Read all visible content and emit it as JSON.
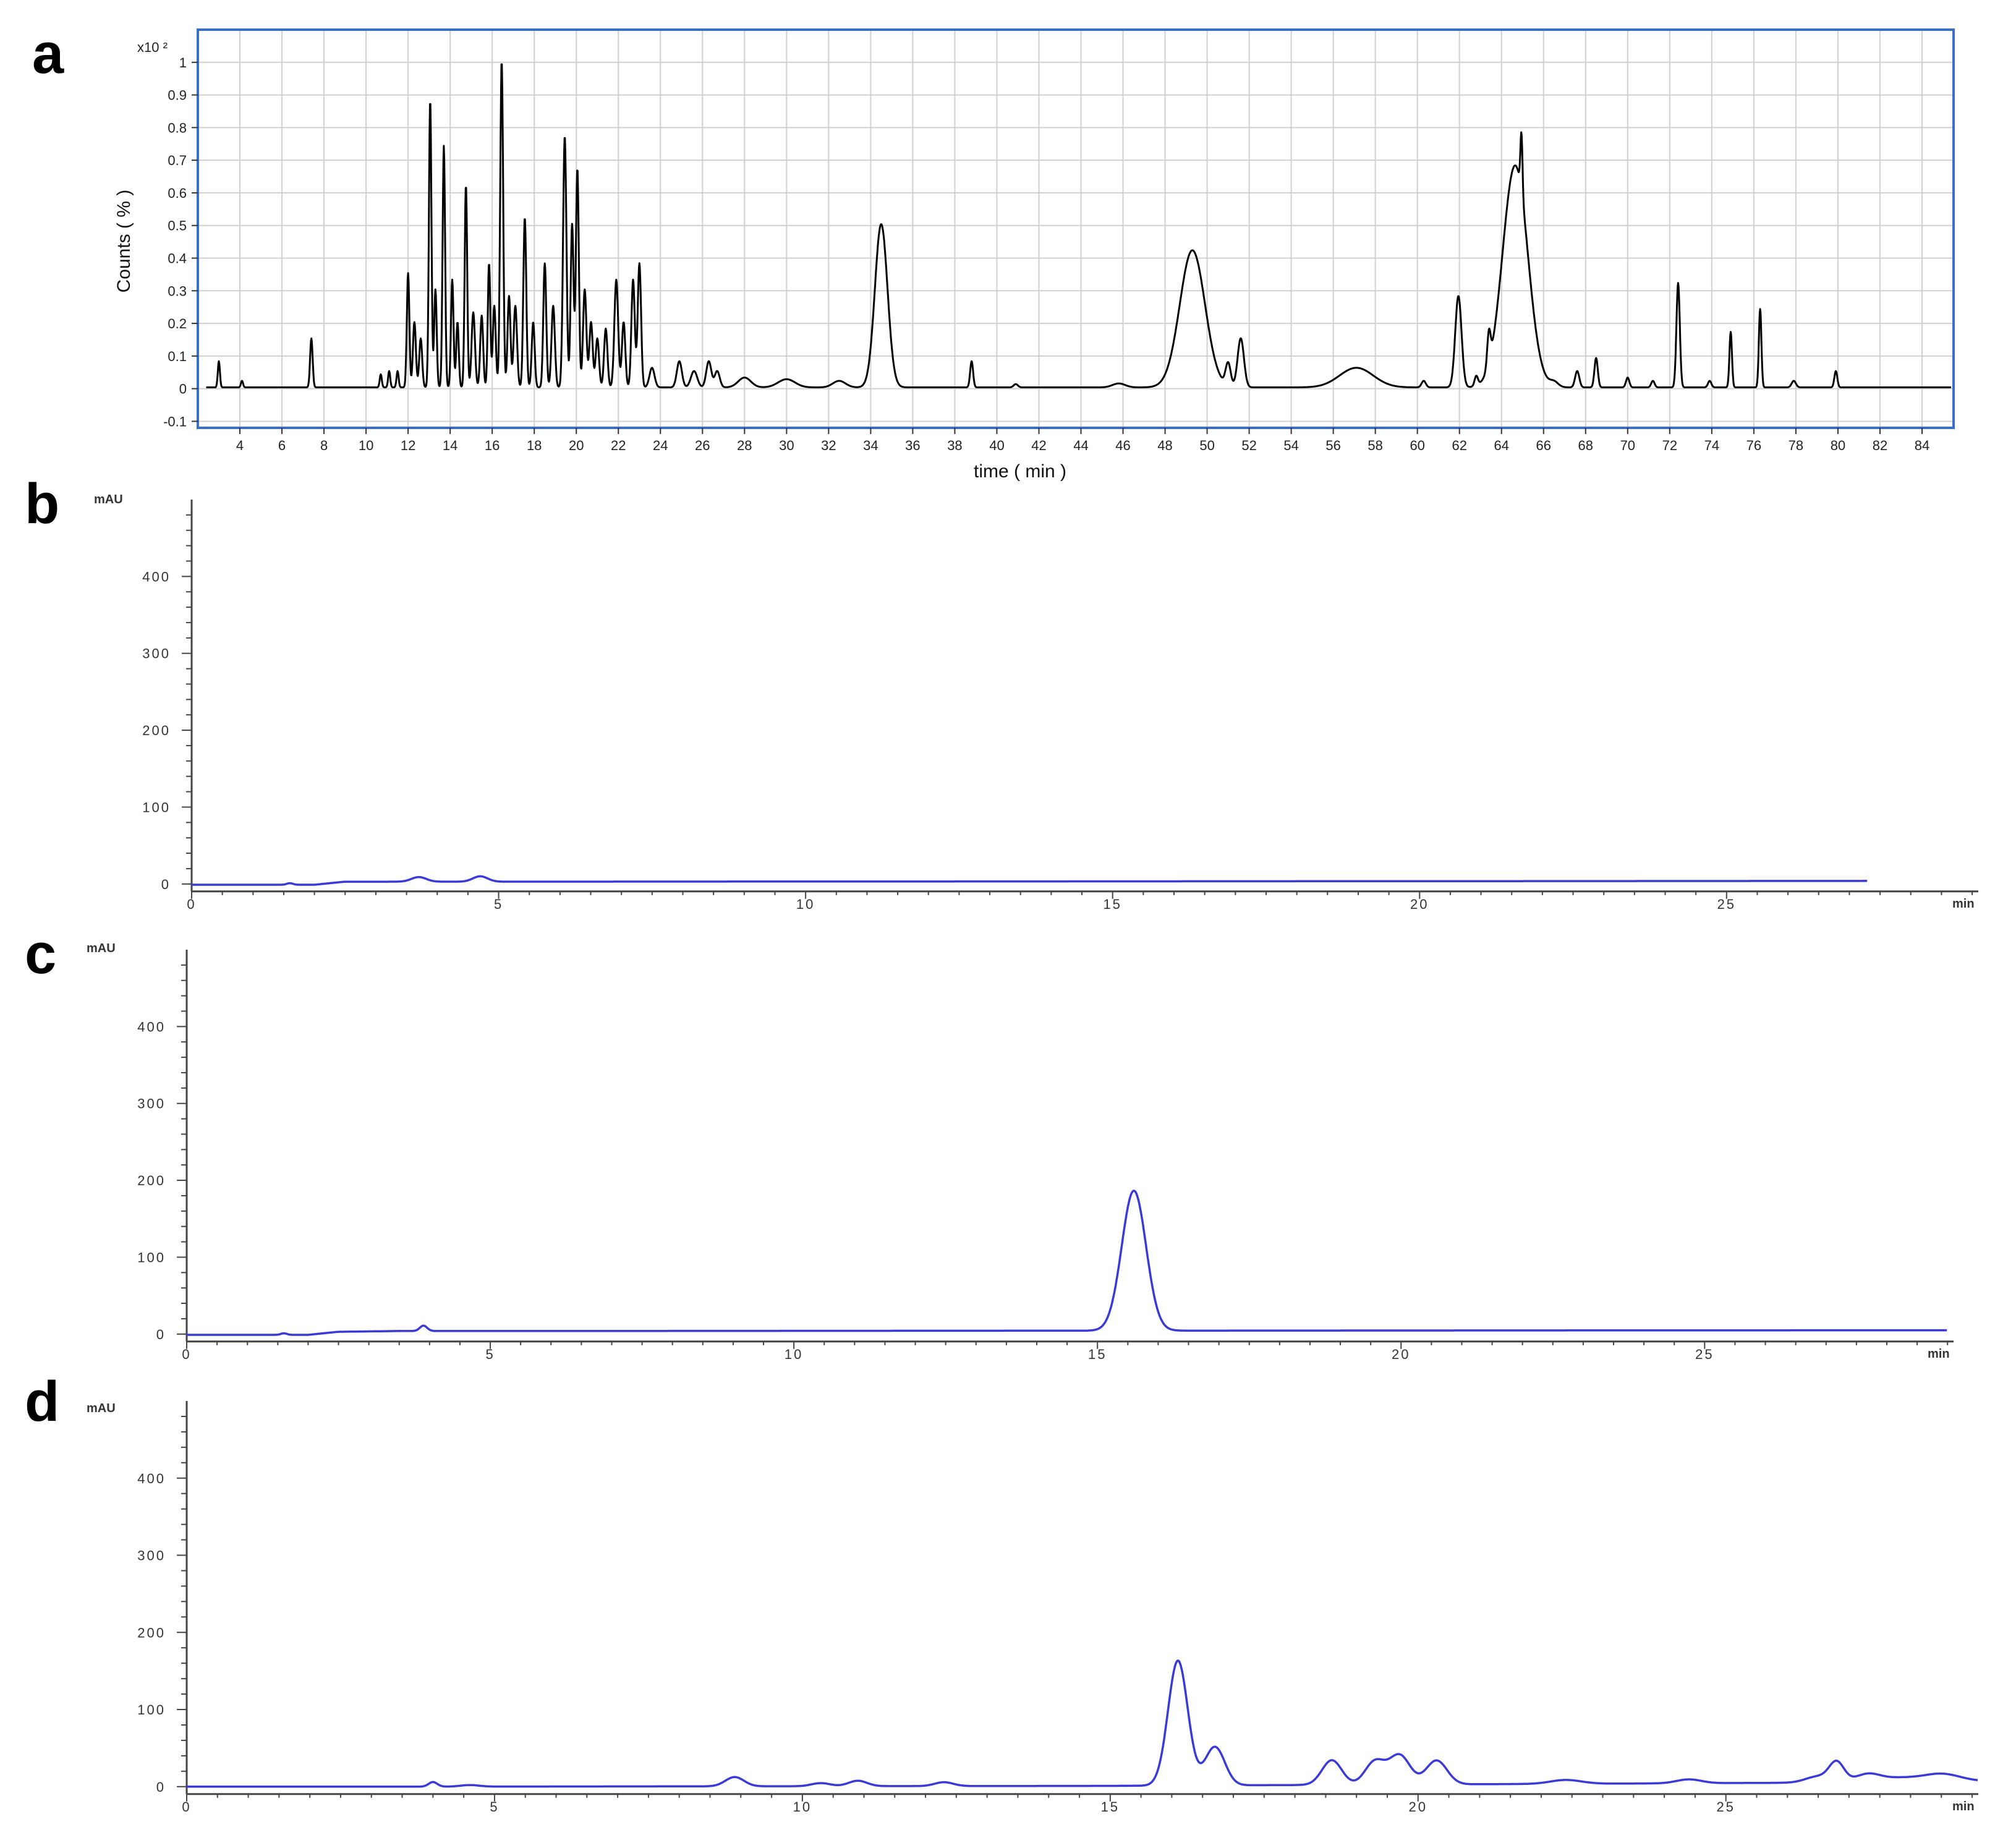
{
  "panels": {
    "a": {
      "letter": "a"
    },
    "b": {
      "letter": "b"
    },
    "c": {
      "letter": "c"
    },
    "d": {
      "letter": "d"
    }
  },
  "colors": {
    "ms_trace": "#000000",
    "uv_trace": "#3a3ad6",
    "frame_a": "#3a6fc4",
    "grid": "#d0d0d0"
  },
  "chart_data": [
    {
      "id": "a",
      "type": "line",
      "title": "",
      "xlabel": "time ( min )",
      "ylabel": "Counts ( % )",
      "yscale_label": "x10 ²",
      "xlim": [
        2,
        85.5
      ],
      "ylim": [
        -0.12,
        1.1
      ],
      "grid": true,
      "xticks": [
        4,
        6,
        8,
        10,
        12,
        14,
        16,
        18,
        20,
        22,
        24,
        26,
        28,
        30,
        32,
        34,
        36,
        38,
        40,
        42,
        44,
        46,
        48,
        50,
        52,
        54,
        56,
        58,
        60,
        62,
        64,
        66,
        68,
        70,
        72,
        74,
        76,
        78,
        80,
        82,
        84
      ],
      "yticks": [
        -0.1,
        0,
        0.1,
        0.2,
        0.3,
        0.4,
        0.5,
        0.6,
        0.7,
        0.8,
        0.9,
        1
      ],
      "ytick_labels": [
        "-0.1",
        "0",
        "0.1",
        "0.2",
        "0.3",
        "0.4",
        "0.5",
        "0.6",
        "0.7",
        "0.8",
        "0.9",
        "1"
      ],
      "baseline": 0.004,
      "peaks": [
        [
          3.0,
          0.08,
          0.05
        ],
        [
          4.1,
          0.02,
          0.05
        ],
        [
          7.4,
          0.15,
          0.06
        ],
        [
          10.7,
          0.04,
          0.05
        ],
        [
          11.1,
          0.05,
          0.05
        ],
        [
          11.5,
          0.05,
          0.05
        ],
        [
          12.0,
          0.35,
          0.06
        ],
        [
          12.3,
          0.2,
          0.07
        ],
        [
          12.6,
          0.15,
          0.07
        ],
        [
          13.05,
          0.88,
          0.06
        ],
        [
          13.3,
          0.3,
          0.06
        ],
        [
          13.7,
          0.74,
          0.06
        ],
        [
          14.1,
          0.33,
          0.06
        ],
        [
          14.35,
          0.2,
          0.06
        ],
        [
          14.75,
          0.62,
          0.06
        ],
        [
          15.1,
          0.23,
          0.08
        ],
        [
          15.5,
          0.22,
          0.07
        ],
        [
          15.85,
          0.38,
          0.06
        ],
        [
          16.1,
          0.25,
          0.07
        ],
        [
          16.45,
          1.0,
          0.07
        ],
        [
          16.8,
          0.28,
          0.07
        ],
        [
          17.1,
          0.25,
          0.08
        ],
        [
          17.55,
          0.52,
          0.07
        ],
        [
          17.95,
          0.2,
          0.07
        ],
        [
          18.5,
          0.38,
          0.07
        ],
        [
          18.9,
          0.25,
          0.08
        ],
        [
          19.45,
          0.77,
          0.08
        ],
        [
          19.8,
          0.5,
          0.07
        ],
        [
          20.05,
          0.67,
          0.07
        ],
        [
          20.4,
          0.3,
          0.08
        ],
        [
          20.7,
          0.2,
          0.08
        ],
        [
          21.0,
          0.15,
          0.08
        ],
        [
          21.4,
          0.18,
          0.08
        ],
        [
          21.9,
          0.33,
          0.09
        ],
        [
          22.25,
          0.2,
          0.08
        ],
        [
          22.7,
          0.33,
          0.08
        ],
        [
          23.0,
          0.38,
          0.08
        ],
        [
          23.6,
          0.06,
          0.12
        ],
        [
          24.9,
          0.08,
          0.12
        ],
        [
          25.6,
          0.05,
          0.15
        ],
        [
          26.3,
          0.08,
          0.12
        ],
        [
          26.7,
          0.05,
          0.12
        ],
        [
          28.0,
          0.03,
          0.3
        ],
        [
          30.0,
          0.025,
          0.4
        ],
        [
          32.5,
          0.02,
          0.3
        ],
        [
          34.5,
          0.5,
          0.3
        ],
        [
          38.8,
          0.08,
          0.07
        ],
        [
          40.9,
          0.01,
          0.1
        ],
        [
          45.8,
          0.012,
          0.3
        ],
        [
          49.3,
          0.42,
          0.6
        ],
        [
          51.0,
          0.07,
          0.12
        ],
        [
          51.6,
          0.15,
          0.15
        ],
        [
          57.1,
          0.06,
          0.8
        ],
        [
          60.3,
          0.02,
          0.1
        ],
        [
          61.95,
          0.28,
          0.15
        ],
        [
          62.8,
          0.03,
          0.08
        ],
        [
          63.4,
          0.1,
          0.08
        ],
        [
          64.65,
          0.68,
          0.6
        ],
        [
          64.95,
          0.18,
          0.05
        ],
        [
          66.5,
          0.015,
          0.2
        ],
        [
          67.6,
          0.05,
          0.1
        ],
        [
          68.5,
          0.09,
          0.08
        ],
        [
          70.0,
          0.03,
          0.08
        ],
        [
          71.2,
          0.02,
          0.08
        ],
        [
          72.4,
          0.32,
          0.08
        ],
        [
          73.9,
          0.02,
          0.08
        ],
        [
          74.9,
          0.17,
          0.06
        ],
        [
          76.3,
          0.24,
          0.06
        ],
        [
          77.9,
          0.02,
          0.1
        ],
        [
          79.9,
          0.05,
          0.07
        ]
      ]
    },
    {
      "id": "b",
      "type": "line",
      "title": "",
      "yunit": "mAU",
      "xunit": "min",
      "xlim": [
        0,
        29.1
      ],
      "ylim": [
        -5,
        500
      ],
      "trace_end": 27.3,
      "xticks": [
        0,
        5,
        10,
        15,
        20,
        25
      ],
      "yticks": [
        0,
        100,
        200,
        300,
        400
      ],
      "baseline": [
        [
          0,
          -1
        ],
        [
          1.5,
          -1
        ],
        [
          2.0,
          -1
        ],
        [
          2.5,
          3
        ],
        [
          3.5,
          3
        ],
        [
          5,
          3
        ],
        [
          28,
          4
        ]
      ],
      "peaks": [
        [
          1.6,
          2,
          0.05
        ],
        [
          3.7,
          6,
          0.12
        ],
        [
          4.7,
          7,
          0.12
        ]
      ]
    },
    {
      "id": "c",
      "type": "line",
      "title": "",
      "yunit": "mAU",
      "xunit": "min",
      "xlim": [
        0,
        29.1
      ],
      "ylim": [
        -5,
        500
      ],
      "trace_end": 29.0,
      "xticks": [
        0,
        5,
        10,
        15,
        20,
        25
      ],
      "yticks": [
        0,
        100,
        200,
        300,
        400
      ],
      "baseline": [
        [
          0,
          -1
        ],
        [
          1.5,
          -1
        ],
        [
          2.0,
          -1
        ],
        [
          2.5,
          3
        ],
        [
          3.5,
          4
        ],
        [
          5,
          4
        ],
        [
          28,
          5
        ]
      ],
      "peaks": [
        [
          1.6,
          2,
          0.05
        ],
        [
          3.9,
          7,
          0.06
        ],
        [
          15.6,
          182,
          0.2
        ]
      ]
    },
    {
      "id": "d",
      "type": "line",
      "title": "",
      "yunit": "mAU",
      "xunit": "min",
      "xlim": [
        0,
        29.1
      ],
      "ylim": [
        -5,
        500
      ],
      "trace_end": 29.1,
      "xticks": [
        0,
        5,
        10,
        15,
        20,
        25
      ],
      "yticks": [
        0,
        100,
        200,
        300,
        400
      ],
      "baseline": [
        [
          0,
          0
        ],
        [
          4,
          0
        ],
        [
          15,
          1
        ],
        [
          26,
          5
        ],
        [
          29.1,
          7
        ]
      ],
      "peaks": [
        [
          4.0,
          6,
          0.07
        ],
        [
          4.6,
          2,
          0.15
        ],
        [
          8.9,
          12,
          0.15
        ],
        [
          10.3,
          4,
          0.15
        ],
        [
          10.9,
          7,
          0.15
        ],
        [
          12.3,
          5,
          0.15
        ],
        [
          16.1,
          162,
          0.16
        ],
        [
          16.7,
          50,
          0.16
        ],
        [
          18.6,
          32,
          0.16
        ],
        [
          19.3,
          30,
          0.16
        ],
        [
          19.7,
          38,
          0.17
        ],
        [
          20.3,
          31,
          0.17
        ],
        [
          22.4,
          5,
          0.25
        ],
        [
          24.4,
          5,
          0.2
        ],
        [
          26.5,
          8,
          0.2
        ],
        [
          26.8,
          25,
          0.12
        ],
        [
          27.3,
          10,
          0.2
        ],
        [
          27.8,
          5,
          0.3
        ],
        [
          28.5,
          10,
          0.3
        ]
      ]
    }
  ]
}
